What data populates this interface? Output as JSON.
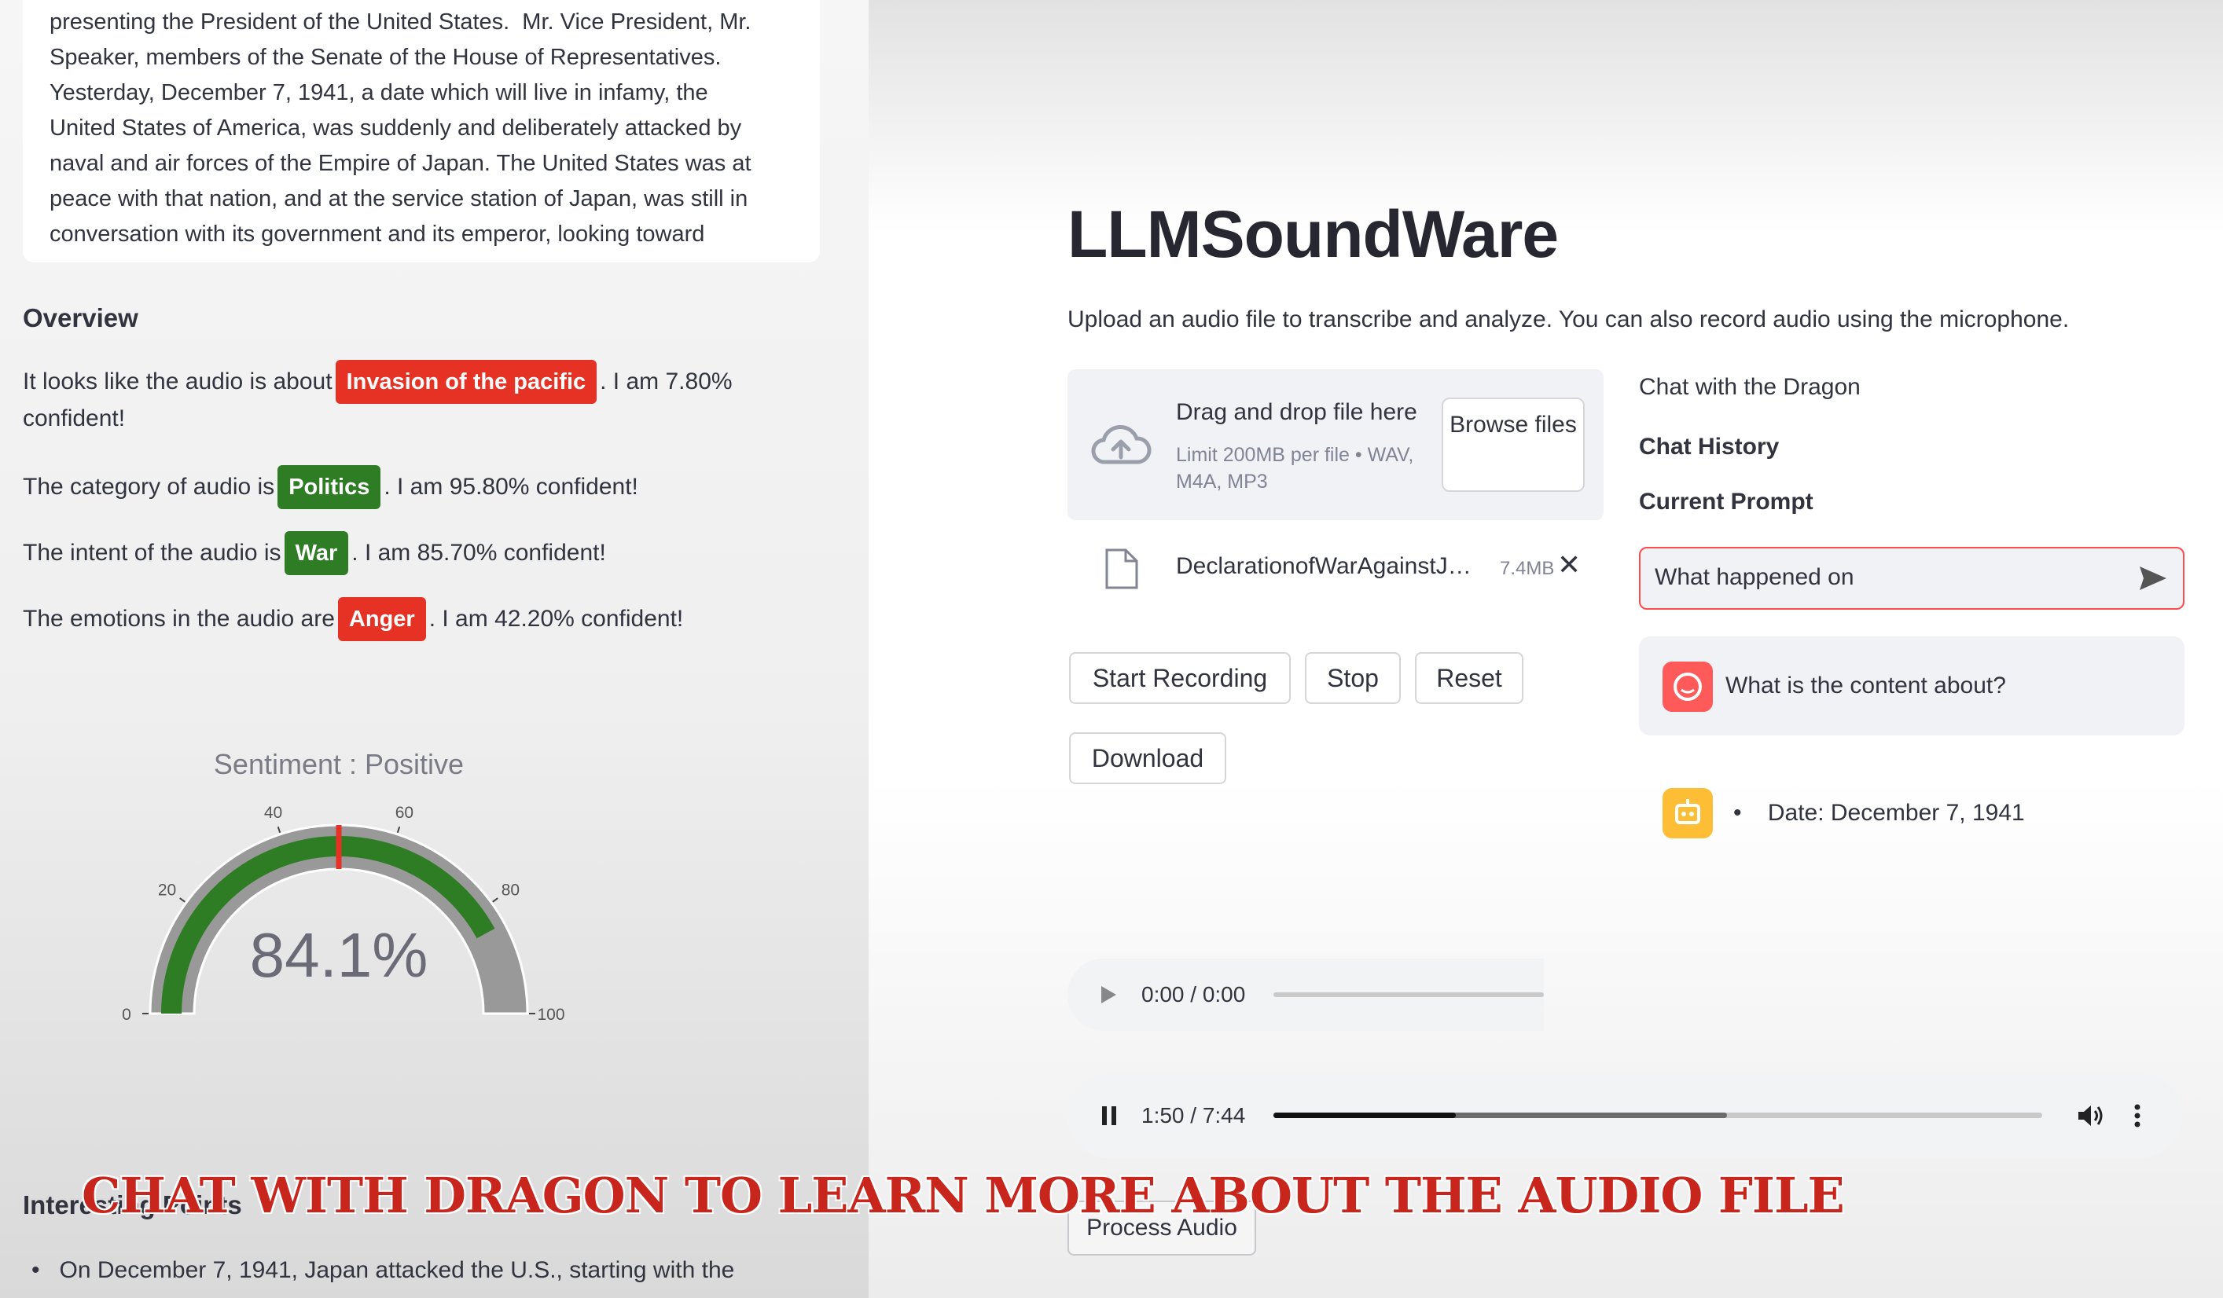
{
  "transcript": {
    "lines": [
      "presenting the President of the United States.  Mr. Vice President, Mr.",
      "Speaker, members of the Senate of the House of Representatives.",
      "Yesterday, December 7, 1941, a date which will live in infamy, the",
      "United States of America, was suddenly and deliberately attacked by",
      "naval and air forces of the Empire of Japan. The United States was at",
      "peace with that nation, and at the service station of Japan, was still in",
      "conversation with its government and its emperor, looking toward"
    ]
  },
  "overview": {
    "heading": "Overview",
    "topic_prefix": "It looks like the audio is about",
    "topic_tag": "Invasion of the pacific",
    "topic_suffix": ". I am 7.80%",
    "topic_suffix2": "confident!",
    "category_prefix": "The category of audio is",
    "category_tag": "Politics",
    "category_suffix": ". I am 95.80% confident!",
    "intent_prefix": "The intent of the audio is",
    "intent_tag": "War",
    "intent_suffix": ". I am 85.70% confident!",
    "emotion_prefix": "The emotions in the audio are",
    "emotion_tag": "Anger",
    "emotion_suffix": ". I am 42.20% confident!"
  },
  "gauge": {
    "title": "Sentiment : Positive",
    "value_label": "84.1%",
    "value": 84.1,
    "threshold": 50,
    "min": 0,
    "max": 100,
    "ticks": [
      "0",
      "20",
      "40",
      "60",
      "80",
      "100"
    ],
    "colors": {
      "bar": "#2e7d24",
      "track": "#999999",
      "threshold": "#e53224"
    }
  },
  "interesting": {
    "heading": "Interesting Points",
    "first_bullet": "On December 7, 1941, Japan attacked the U.S., starting with the"
  },
  "app": {
    "title": "LLMSoundWare",
    "subtitle": "Upload an audio file to transcribe and analyze. You can also record audio using the microphone."
  },
  "uploader": {
    "title": "Drag and drop file here",
    "limit": "Limit 200MB per file • WAV, M4A, MP3",
    "browse_label": "Browse files",
    "file_name": "DeclarationofWarAgainstJ…",
    "file_size": "7.4MB"
  },
  "recorder": {
    "start": "Start Recording",
    "stop": "Stop",
    "reset": "Reset",
    "download": "Download"
  },
  "player1": {
    "time": "0:00 / 0:00",
    "progress": 0
  },
  "player2": {
    "time": "1:50 / 7:44",
    "progress": 0.237,
    "buffered": 0.59
  },
  "process_button": "Process Audio",
  "chat": {
    "title": "Chat with the Dragon",
    "history_heading": "Chat History",
    "current_prompt_heading": "Current Prompt",
    "prompt_value": "What happened on",
    "user_message": "What is the content about?",
    "bot_message": "Date: December 7, 1941"
  },
  "caption": "CHAT WITH DRAGON TO LEARN MORE ABOUT THE AUDIO FILE",
  "colors": {
    "accent": "#ff4b4b",
    "tag_red": "#e53224",
    "tag_green": "#2e7d24"
  }
}
